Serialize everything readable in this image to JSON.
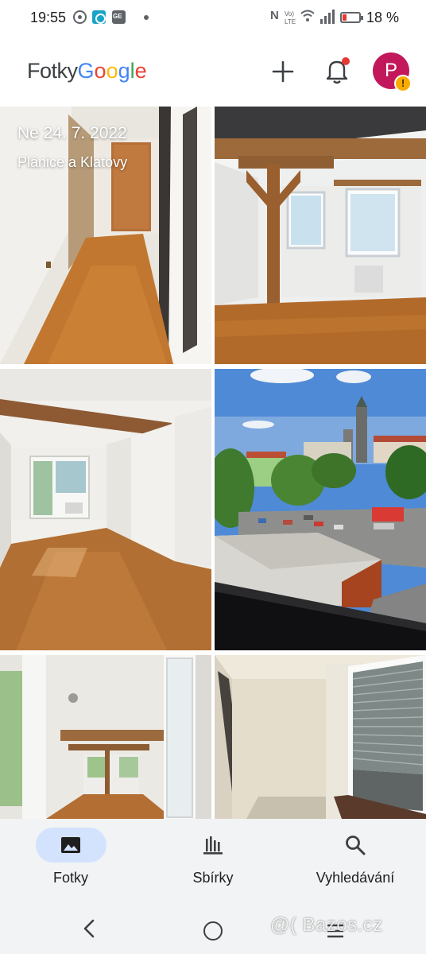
{
  "status_bar": {
    "time": "19:55",
    "battery_percent": "18 %",
    "battery_level": 0.18,
    "icons": [
      "chrome-icon",
      "app-icon",
      "ge-icon",
      "nfc-icon",
      "volte-icon",
      "wifi-icon",
      "signal-icon",
      "battery-icon"
    ]
  },
  "header": {
    "logo_word": "Fotky",
    "logo_google": [
      "G",
      "o",
      "o",
      "g",
      "l",
      "e"
    ],
    "logo_colors": [
      "#4285F4",
      "#EA4335",
      "#FBBC05",
      "#4285F4",
      "#34A853",
      "#EA4335"
    ],
    "avatar_initial": "P",
    "avatar_color": "#c2185b",
    "avatar_warning": "!",
    "notification_badge_color": "#e53935"
  },
  "photos": {
    "date": "Ne 24. 7. 2022",
    "place": "Plánice a Klatovy"
  },
  "bottom_nav": {
    "items": [
      {
        "label": "Fotky",
        "icon": "photo-icon",
        "active": true
      },
      {
        "label": "Sbírky",
        "icon": "collections-icon",
        "active": false
      },
      {
        "label": "Vyhledávání",
        "icon": "search-icon",
        "active": false
      }
    ],
    "active_color": "#d3e3fd"
  },
  "watermark": "@( Bazos.cz"
}
